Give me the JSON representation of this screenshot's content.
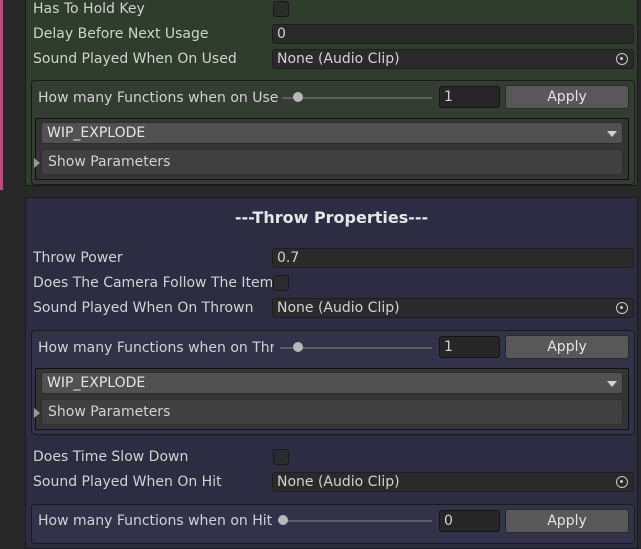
{
  "grab_section": {
    "has_to_hold_key_label": "Has To Hold Key",
    "delay_label": "Delay Before Next Usage",
    "delay_value": "0",
    "sound_used_label": "Sound Played When On Used",
    "sound_used_value": "None (Audio Clip)",
    "functions": {
      "label": "How many Functions when on Used",
      "value": "1",
      "apply_label": "Apply",
      "slider_fraction": 0.07,
      "dropdown_value": "WIP_EXPLODE",
      "show_parameters_label": "Show Parameters"
    }
  },
  "throw_section": {
    "header": "---Throw Properties---",
    "throw_power_label": "Throw Power",
    "throw_power_value": "0.7",
    "camera_follow_label": "Does The Camera Follow The Item",
    "sound_thrown_label": "Sound Played When On Thrown",
    "sound_thrown_value": "None (Audio Clip)",
    "functions": {
      "label": "How many Functions when on Thrown",
      "value": "1",
      "apply_label": "Apply",
      "slider_fraction": 0.07,
      "dropdown_value": "WIP_EXPLODE",
      "show_parameters_label": "Show Parameters"
    },
    "time_slow_label": "Does Time Slow Down",
    "sound_hit_label": "Sound Played When On Hit",
    "sound_hit_value": "None (Audio Clip)",
    "hit_functions": {
      "label": "How many Functions when on Hit",
      "value": "0",
      "apply_label": "Apply",
      "slider_fraction": 0
    }
  },
  "colors": {
    "grab_panel": "#2f3d2c",
    "throw_panel": "#2c2d43",
    "editor_bg": "#282828"
  }
}
